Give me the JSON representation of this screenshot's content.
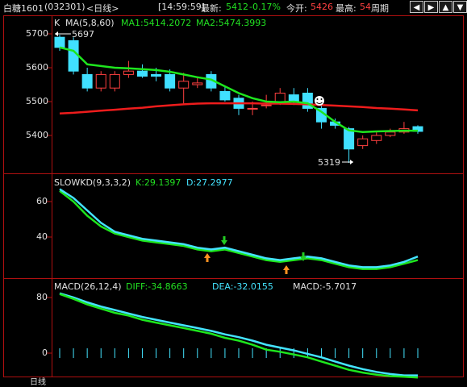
{
  "titlebar": {
    "instrument": "白糖1601",
    "code": "(032301)",
    "period": "<日线>",
    "time": "[14:59:59]",
    "latest_label": "最新:",
    "latest_value": "5412",
    "change": "-0.17%",
    "open_label": "今开:",
    "open_value": "5426",
    "high_label": "最高:",
    "high_value": "54",
    "cycle_label": "周期",
    "nav_icons": [
      "arrow-left-icon",
      "arrow-right-icon",
      "arrow-up-icon",
      "arrow-down-icon"
    ]
  },
  "price_panel": {
    "k_label": "K",
    "ma_header": "MA(5,8,60)",
    "ma1": "MA1:5414.2072",
    "ma2": "MA2:5474.3993",
    "high_mark": "5697",
    "low_mark": "5319",
    "y_ticks": [
      "5700",
      "5600",
      "5500",
      "5400"
    ]
  },
  "kd_panel": {
    "header": "SLOWKD(9,3,3,2)",
    "k": "K:29.1397",
    "d": "D:27.2977",
    "y_ticks": [
      "60",
      "40"
    ]
  },
  "macd_panel": {
    "header": "MACD(26,12,4)",
    "diff": "DIFF:-34.8663",
    "dea": "DEA:-32.0155",
    "macd": "MACD:-5.7017",
    "y_ticks": [
      "80",
      "0"
    ]
  },
  "footer": {
    "label": "日线"
  },
  "colors": {
    "up": "#ff4040",
    "down": "#40e0ff",
    "ma_long": "#ee1c1c",
    "ma_short": "#1ee61e",
    "kd_k": "#44e4ff",
    "kd_d": "#1ee61e"
  },
  "chart_data": [
    {
      "type": "candlestick",
      "title": "白糖1601 日线",
      "ylim": [
        5300,
        5760
      ],
      "candles": [
        {
          "o": 5690,
          "h": 5697,
          "c": 5660,
          "l": 5650
        },
        {
          "o": 5680,
          "h": 5690,
          "c": 5590,
          "l": 5580
        },
        {
          "o": 5580,
          "h": 5600,
          "c": 5540,
          "l": 5530
        },
        {
          "o": 5540,
          "h": 5590,
          "c": 5580,
          "l": 5530
        },
        {
          "o": 5540,
          "h": 5590,
          "c": 5580,
          "l": 5530
        },
        {
          "o": 5580,
          "h": 5620,
          "c": 5590,
          "l": 5570
        },
        {
          "o": 5590,
          "h": 5610,
          "c": 5575,
          "l": 5570
        },
        {
          "o": 5580,
          "h": 5600,
          "c": 5575,
          "l": 5560
        },
        {
          "o": 5580,
          "h": 5595,
          "c": 5540,
          "l": 5530
        },
        {
          "o": 5540,
          "h": 5585,
          "c": 5560,
          "l": 5490
        },
        {
          "o": 5550,
          "h": 5570,
          "c": 5555,
          "l": 5540
        },
        {
          "o": 5580,
          "h": 5590,
          "c": 5540,
          "l": 5530
        },
        {
          "o": 5530,
          "h": 5545,
          "c": 5505,
          "l": 5500
        },
        {
          "o": 5510,
          "h": 5520,
          "c": 5480,
          "l": 5460
        },
        {
          "o": 5480,
          "h": 5500,
          "c": 5480,
          "l": 5460
        },
        {
          "o": 5490,
          "h": 5520,
          "c": 5490,
          "l": 5480
        },
        {
          "o": 5500,
          "h": 5540,
          "c": 5525,
          "l": 5490
        },
        {
          "o": 5520,
          "h": 5540,
          "c": 5500,
          "l": 5490
        },
        {
          "o": 5525,
          "h": 5540,
          "c": 5480,
          "l": 5470
        },
        {
          "o": 5480,
          "h": 5500,
          "c": 5440,
          "l": 5420
        },
        {
          "o": 5440,
          "h": 5450,
          "c": 5430,
          "l": 5420
        },
        {
          "o": 5420,
          "h": 5425,
          "c": 5360,
          "l": 5319
        },
        {
          "o": 5370,
          "h": 5400,
          "c": 5390,
          "l": 5360
        },
        {
          "o": 5385,
          "h": 5410,
          "c": 5400,
          "l": 5375
        },
        {
          "o": 5400,
          "h": 5420,
          "c": 5410,
          "l": 5395
        },
        {
          "o": 5410,
          "h": 5440,
          "c": 5420,
          "l": 5405
        },
        {
          "o": 5426,
          "h": 5430,
          "c": 5412,
          "l": 5405
        }
      ],
      "series": [
        {
          "name": "MA1",
          "values": [
            5660,
            5650,
            5610,
            5605,
            5600,
            5598,
            5596,
            5593,
            5588,
            5580,
            5572,
            5565,
            5545,
            5525,
            5510,
            5500,
            5498,
            5500,
            5495,
            5470,
            5440,
            5415,
            5410,
            5412,
            5413,
            5414,
            5414
          ]
        },
        {
          "name": "MA2",
          "values": [
            5465,
            5467,
            5470,
            5473,
            5476,
            5479,
            5482,
            5486,
            5489,
            5492,
            5494,
            5495,
            5495,
            5495,
            5495,
            5494,
            5494,
            5493,
            5492,
            5490,
            5488,
            5486,
            5484,
            5481,
            5479,
            5477,
            5474
          ]
        }
      ]
    },
    {
      "type": "line",
      "title": "SLOWKD(9,3,3,2)",
      "ylim": [
        20,
        70
      ],
      "series": [
        {
          "name": "K",
          "values": [
            67,
            62,
            55,
            48,
            43,
            41,
            39,
            38,
            37,
            36,
            34,
            33,
            34,
            32,
            30,
            28,
            27,
            28,
            29,
            28,
            26,
            24,
            23,
            23,
            24,
            26,
            29
          ]
        },
        {
          "name": "D",
          "values": [
            66,
            60,
            52,
            46,
            42,
            40,
            38,
            37,
            36,
            35,
            33,
            32,
            33,
            31,
            29,
            27,
            26,
            27,
            28,
            27,
            25,
            23,
            22,
            22,
            23,
            25,
            27
          ]
        }
      ]
    },
    {
      "type": "line",
      "title": "MACD(26,12,4)",
      "ylim": [
        -40,
        90
      ],
      "series": [
        {
          "name": "DIFF",
          "values": [
            85,
            78,
            70,
            64,
            58,
            54,
            48,
            44,
            40,
            36,
            32,
            28,
            22,
            18,
            12,
            5,
            2,
            -2,
            -6,
            -12,
            -18,
            -24,
            -28,
            -31,
            -33,
            -34,
            -35
          ]
        },
        {
          "name": "DEA",
          "values": [
            86,
            80,
            73,
            67,
            62,
            57,
            52,
            48,
            44,
            40,
            36,
            32,
            27,
            23,
            18,
            12,
            8,
            4,
            -1,
            -6,
            -12,
            -18,
            -23,
            -27,
            -30,
            -32,
            -32
          ]
        }
      ]
    }
  ]
}
